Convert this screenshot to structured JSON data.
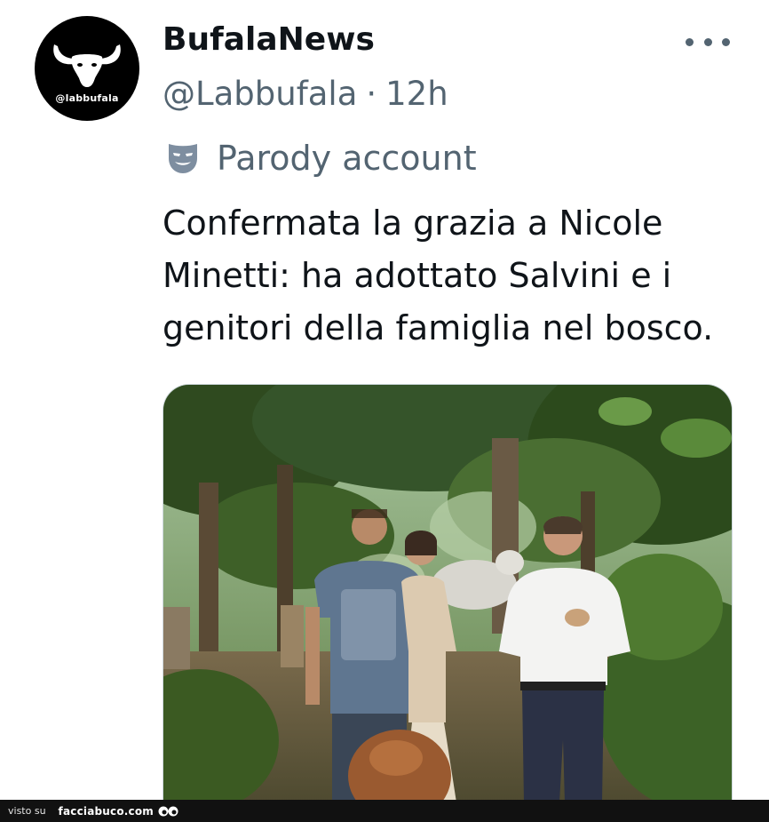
{
  "tweet": {
    "author": {
      "display_name": "BufalaNews",
      "avatar_text": "@labbufala",
      "avatar_icon": "bull-skull-icon"
    },
    "handle": "@Labbufala",
    "separator": "·",
    "time": "12h",
    "more_icon": "more-dots-icon",
    "parody_label": "Parody account",
    "parody_icon": "theater-mask-icon",
    "text_lines": [
      "Confermata la grazia a Nicole",
      "Minetti: ha adottato Salvini e i",
      "genitori della famiglia nel bosco."
    ],
    "media_icon": "photo-forest-people"
  },
  "footer": {
    "prefix": "visto su",
    "site": "facciabuco.com",
    "logo_icon": "eyes-icon"
  },
  "colors": {
    "text_primary": "#0f1419",
    "text_secondary": "#536471",
    "avatar_bg": "#000000",
    "footer_bg": "#111111",
    "parody_icon": "#7e8ea0"
  }
}
